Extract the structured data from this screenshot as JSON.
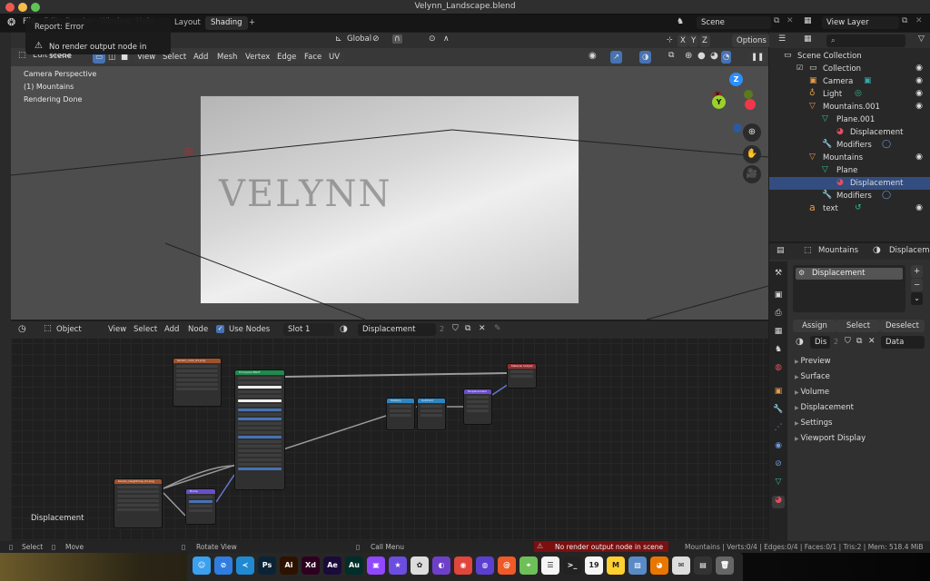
{
  "window": {
    "title": "Velynn_Landscape.blend"
  },
  "topbar": {
    "menus": [
      "File",
      "Edit",
      "Render",
      "Window",
      "Help"
    ],
    "workspaces": [
      {
        "label": "Layout",
        "active": false
      },
      {
        "label": "Shading",
        "active": true
      }
    ],
    "add_workspace": "+",
    "scene_field": "Scene",
    "view_layer_field": "View Layer"
  },
  "report": {
    "title": "Report: Error",
    "message": "No render output node in scene"
  },
  "viewport": {
    "mode": "Edit Mode",
    "menus": [
      "View",
      "Select",
      "Add",
      "Mesh",
      "Vertex",
      "Edge",
      "Face",
      "UV"
    ],
    "transform_orientation": "Global",
    "axes": [
      "X",
      "Y",
      "Z"
    ],
    "options_label": "Options",
    "info": [
      "Camera Perspective",
      "(1) Mountains",
      "Rendering Done"
    ],
    "render_logo_text": "VELYNN",
    "gizmo": {
      "x": "X",
      "y": "Y",
      "z": "Z"
    }
  },
  "node_editor": {
    "type": "Object",
    "menus": [
      "View",
      "Select",
      "Add",
      "Node"
    ],
    "use_nodes_label": "Use Nodes",
    "use_nodes_checked": true,
    "slot": "Slot 1",
    "material": "Displacement",
    "users": "2",
    "region_label": "Displacement",
    "nodes": [
      {
        "title": "terrain_color_01.png",
        "type": "image"
      },
      {
        "title": "Principled BSDF",
        "type": "shader"
      },
      {
        "title": "terrain_heightmap_01.png",
        "type": "image"
      },
      {
        "title": "Bump",
        "type": "vector"
      },
      {
        "title": "Multiply",
        "type": "math"
      },
      {
        "title": "Subtract",
        "type": "math"
      },
      {
        "title": "Displacement",
        "type": "vector"
      },
      {
        "title": "Material Output",
        "type": "output"
      }
    ]
  },
  "outliner": {
    "search_placeholder": "",
    "items": [
      {
        "label": "Scene Collection",
        "icon": "collection-icon"
      },
      {
        "label": "Collection",
        "icon": "collection-icon",
        "visible": true
      },
      {
        "label": "Camera",
        "icon": "camera-icon",
        "visible": true
      },
      {
        "label": "Light",
        "icon": "light-icon",
        "visible": true
      },
      {
        "label": "Mountains.001",
        "icon": "mesh-icon",
        "visible": true
      },
      {
        "label": "Plane.001",
        "icon": "mesh-data-icon"
      },
      {
        "label": "Displacement",
        "icon": "material-icon"
      },
      {
        "label": "Modifiers",
        "icon": "wrench-icon"
      },
      {
        "label": "Mountains",
        "icon": "mesh-icon",
        "visible": true
      },
      {
        "label": "Plane",
        "icon": "mesh-data-icon"
      },
      {
        "label": "Displacement",
        "icon": "material-icon",
        "selected": true
      },
      {
        "label": "Modifiers",
        "icon": "wrench-icon"
      },
      {
        "label": "text",
        "icon": "text-icon",
        "visible": true
      }
    ]
  },
  "properties": {
    "object": "Mountains",
    "material": "Displacement",
    "slot_item": "Displacement",
    "assign_label": "Assign",
    "select_label": "Select",
    "deselect_label": "Deselect",
    "material_short": "Dis",
    "users": "2",
    "link_type": "Data",
    "panels": [
      "Preview",
      "Surface",
      "Volume",
      "Displacement",
      "Settings",
      "Viewport Display"
    ]
  },
  "statusbar": {
    "select": "Select",
    "move": "Move",
    "rotate": "Rotate View",
    "call_menu": "Call Menu",
    "error": "No render output node in scene",
    "stats": "Mountains | Verts:0/4 | Edges:0/4 | Faces:0/1 | Tris:2 | Mem: 518.4 MiB"
  },
  "dock": {
    "apps": [
      {
        "name": "Finder",
        "glyph": "☺",
        "color": "#3aa0f0"
      },
      {
        "name": "Safari",
        "glyph": "⊘",
        "color": "#2f7de1"
      },
      {
        "name": "VS Code",
        "glyph": "≺",
        "color": "#1f8ad2"
      },
      {
        "name": "Photoshop",
        "glyph": "Ps",
        "color": "#0b2336"
      },
      {
        "name": "Illustrator",
        "glyph": "Ai",
        "color": "#2d1200"
      },
      {
        "name": "XD",
        "glyph": "Xd",
        "color": "#2e001f"
      },
      {
        "name": "After Effects",
        "glyph": "Ae",
        "color": "#1b0b3b"
      },
      {
        "name": "Audition",
        "glyph": "Au",
        "color": "#002e2a"
      },
      {
        "name": "Twitch",
        "glyph": "▣",
        "color": "#9146ff"
      },
      {
        "name": "iMovie",
        "glyph": "★",
        "color": "#6b4de0"
      },
      {
        "name": "Photos",
        "glyph": "✿",
        "color": "#ddd"
      },
      {
        "name": "GitHub Desktop",
        "glyph": "◐",
        "color": "#6e40c9"
      },
      {
        "name": "Chrome",
        "glyph": "◉",
        "color": "#e0463b"
      },
      {
        "name": "Siri",
        "glyph": "◍",
        "color": "#5a3fd1"
      },
      {
        "name": "Houdini",
        "glyph": "@",
        "color": "#ef5a26"
      },
      {
        "name": "Maps",
        "glyph": "⌖",
        "color": "#6fbf59"
      },
      {
        "name": "Reminders",
        "glyph": "☰",
        "color": "#f5f5f5"
      },
      {
        "name": "Terminal",
        "glyph": ">_",
        "color": "#222"
      },
      {
        "name": "Calendar",
        "glyph": "19",
        "color": "#f5f5f5"
      },
      {
        "name": "Miro",
        "glyph": "M",
        "color": "#ffd02f"
      },
      {
        "name": "Preview",
        "glyph": "▨",
        "color": "#5a8ac6"
      },
      {
        "name": "Blender",
        "glyph": "◕",
        "color": "#ea7600"
      },
      {
        "name": "Downloads",
        "glyph": "✉",
        "color": "#ddd"
      },
      {
        "name": "Documents",
        "glyph": "▤",
        "color": "#333"
      },
      {
        "name": "Trash",
        "glyph": "🗑",
        "color": "#666"
      }
    ]
  }
}
